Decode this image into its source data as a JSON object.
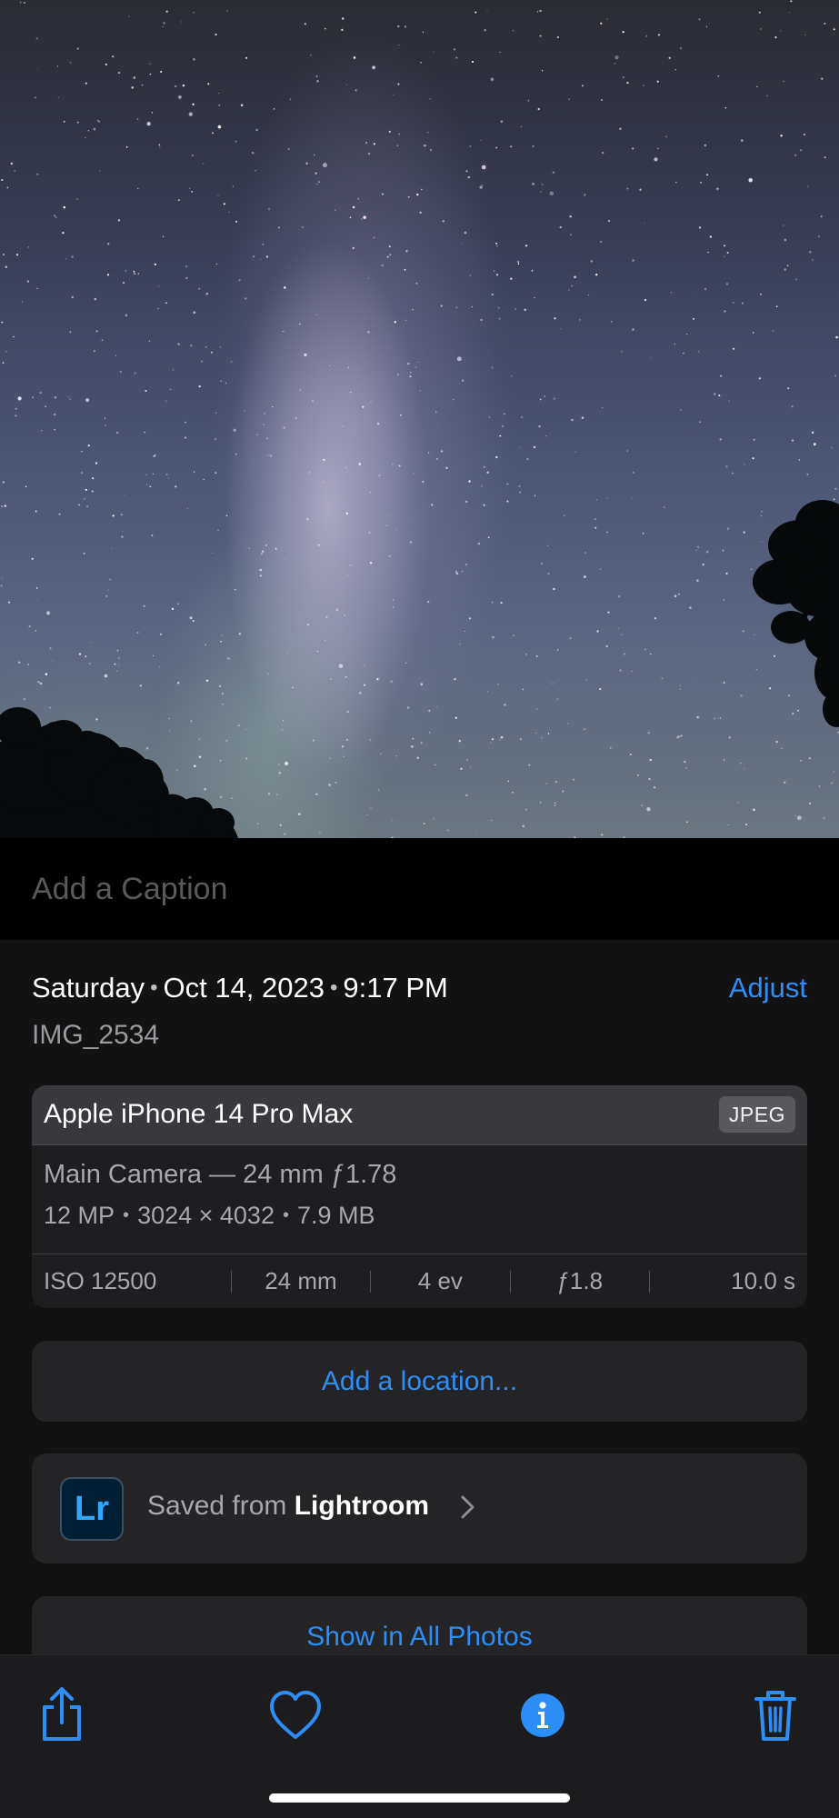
{
  "caption": {
    "placeholder": "Add a Caption"
  },
  "details": {
    "day": "Saturday",
    "date": "Oct 14, 2023",
    "time": "9:17 PM",
    "adjust_label": "Adjust",
    "filename": "IMG_2534"
  },
  "camera": {
    "device": "Apple iPhone 14 Pro Max",
    "format": "JPEG",
    "lens": "Main Camera — 24 mm ƒ1.78",
    "megapixels": "12 MP",
    "resolution": "3024 × 4032",
    "file_size": "7.9 MB",
    "exif": {
      "iso": "ISO 12500",
      "focal_length": "24 mm",
      "exposure_value": "4 ev",
      "aperture": "ƒ1.8",
      "shutter": "10.0 s"
    }
  },
  "location": {
    "label": "Add a location..."
  },
  "source": {
    "prefix": "Saved from ",
    "app": "Lightroom",
    "logo_text": "Lr"
  },
  "show_all": {
    "label": "Show in All Photos"
  },
  "toolbar": {
    "icons": [
      "share-icon",
      "heart-icon",
      "info-icon",
      "trash-icon"
    ]
  },
  "colors": {
    "accent": "#2e8ef7",
    "background": "#121212",
    "card": "#242426",
    "lightroom_blue": "#31a8ff"
  }
}
